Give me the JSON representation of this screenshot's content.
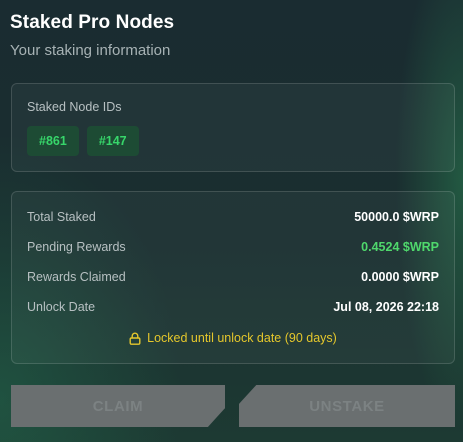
{
  "header": {
    "title": "Staked Pro Nodes",
    "subtitle": "Your staking information"
  },
  "node_ids": {
    "label": "Staked Node IDs",
    "items": [
      "#861",
      "#147"
    ]
  },
  "stats": {
    "rows": [
      {
        "label": "Total Staked",
        "value": "50000.0 $WRP"
      },
      {
        "label": "Pending Rewards",
        "value": "0.4524 $WRP"
      },
      {
        "label": "Rewards Claimed",
        "value": "0.0000 $WRP"
      },
      {
        "label": "Unlock Date",
        "value": "Jul 08, 2026 22:18"
      }
    ],
    "lock_note": "Locked until unlock date (90 days)"
  },
  "actions": {
    "claim_label": "CLAIM",
    "unstake_label": "UNSTAKE"
  },
  "colors": {
    "accent_green": "#4fd86c",
    "lock_yellow": "#e5c72c",
    "disabled_button": "#6a6f70"
  },
  "icons": {
    "lock_note": "lock-icon"
  }
}
